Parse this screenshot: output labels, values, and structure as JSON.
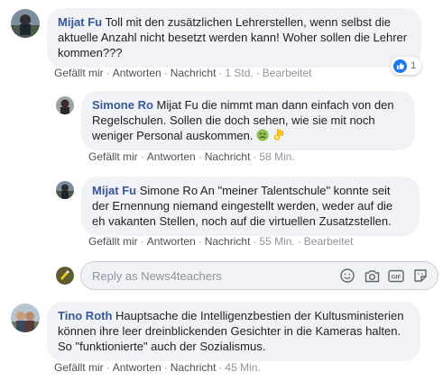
{
  "comments": [
    {
      "author": "Mijat Fu",
      "text": "Toll mit den zusätzlichen Lehrerstellen, wenn selbst die aktuelle Anzahl nicht besetzt werden kann! Woher sollen die Lehrer kommen???",
      "actions": {
        "like": "Gefällt mir",
        "reply": "Antworten",
        "message": "Nachricht",
        "time": "1 Std.",
        "edited": "Bearbeitet"
      },
      "reactions": {
        "count": "1",
        "icon": "like-icon"
      }
    },
    {
      "author": "Simone Ro",
      "text": "Mijat Fu die nimmt man dann einfach von den Regelschulen. Sollen die doch sehen, wie sie mit noch weniger Personal auskommen.",
      "emojis": [
        "nauseated-face-emoji",
        "ok-hand-emoji"
      ],
      "actions": {
        "like": "Gefällt mir",
        "reply": "Antworten",
        "message": "Nachricht",
        "time": "58 Min."
      }
    },
    {
      "author": "Mijat Fu",
      "text": "Simone Ro An \"meiner Talentschule\" konnte seit der Ernennung niemand eingestellt werden, weder auf die eh vakanten Stellen, noch auf die virtuellen Zusatzstellen.",
      "actions": {
        "like": "Gefällt mir",
        "reply": "Antworten",
        "message": "Nachricht",
        "time": "55 Min.",
        "edited": "Bearbeitet"
      }
    },
    {
      "author": "Tino Roth",
      "text": "Hauptsache die Intelligenzbestien der Kultusministerien können ihre leer dreinblickenden Gesichter in die Kameras halten. So \"funktionierte\" auch der Sozialismus.",
      "actions": {
        "like": "Gefällt mir",
        "reply": "Antworten",
        "message": "Nachricht",
        "time": "45 Min."
      }
    }
  ],
  "reply_box": {
    "placeholder": "Reply as News4teachers",
    "icons": [
      "emoji-icon",
      "camera-icon",
      "gif-icon",
      "sticker-icon"
    ]
  },
  "colors": {
    "author": "#365899",
    "bubble": "#f0f2f5",
    "like_blue": "#1877f2",
    "meta": "#90949c"
  }
}
